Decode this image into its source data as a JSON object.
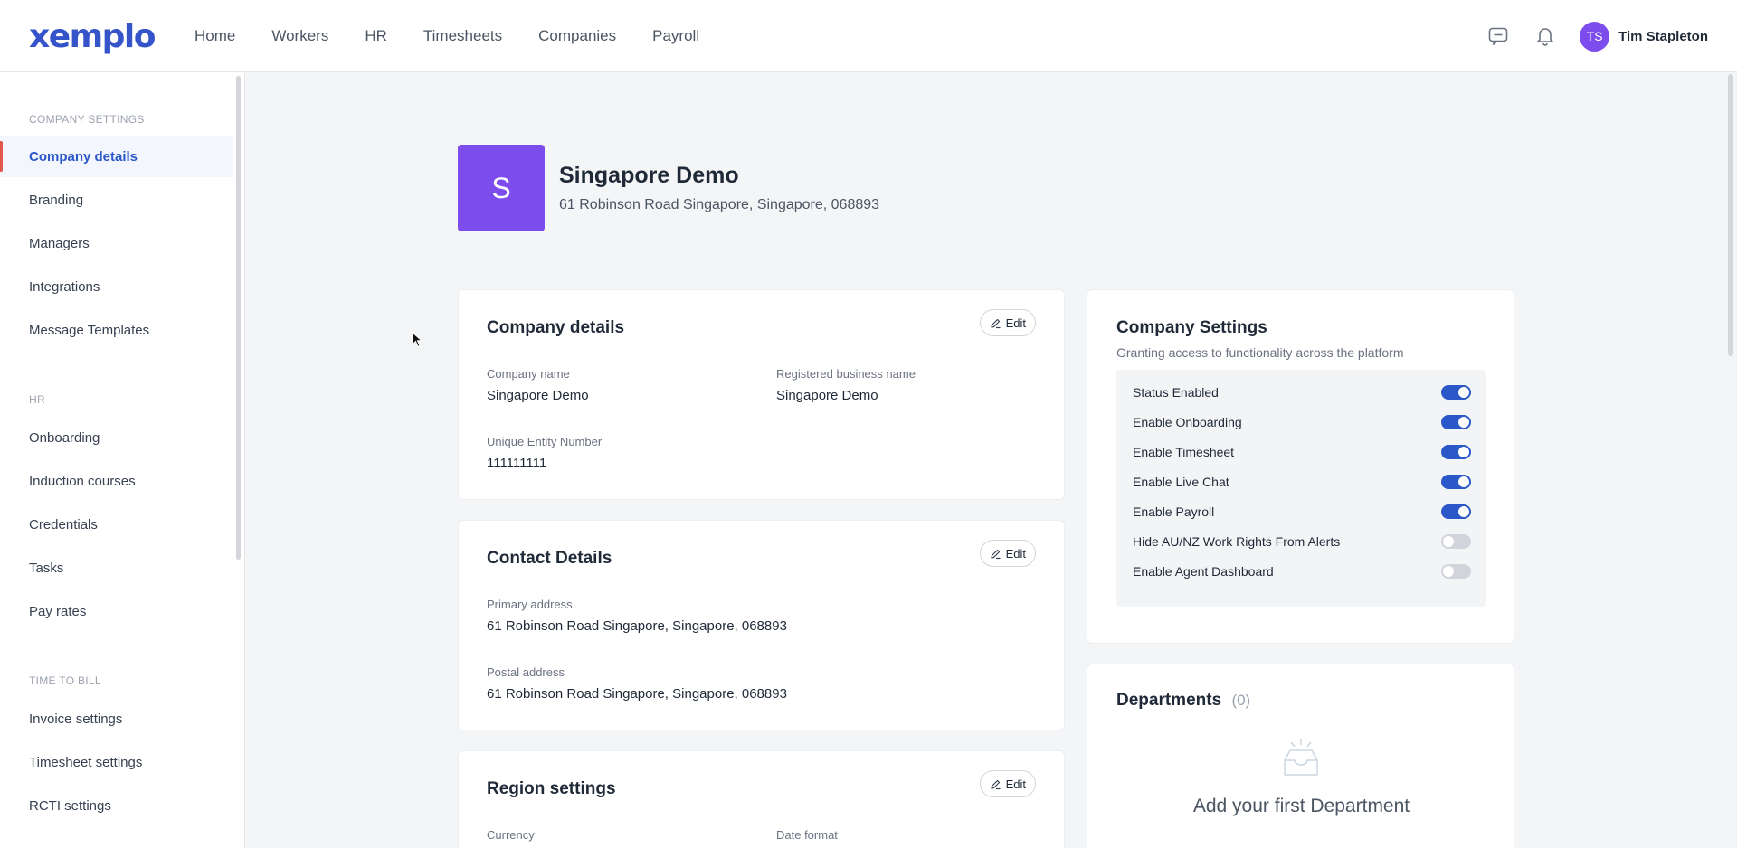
{
  "header": {
    "logo": "xemplo",
    "nav": [
      "Home",
      "Workers",
      "HR",
      "Timesheets",
      "Companies",
      "Payroll"
    ],
    "user_initials": "TS",
    "user_name": "Tim Stapleton",
    "icons": [
      "chat-icon",
      "bell-icon"
    ]
  },
  "sidebar": {
    "sections": [
      {
        "title": "COMPANY SETTINGS",
        "items": [
          "Company details",
          "Branding",
          "Managers",
          "Integrations",
          "Message Templates"
        ]
      },
      {
        "title": "HR",
        "items": [
          "Onboarding",
          "Induction courses",
          "Credentials",
          "Tasks",
          "Pay rates"
        ]
      },
      {
        "title": "TIME TO BILL",
        "items": [
          "Invoice settings",
          "Timesheet settings",
          "RCTI settings"
        ]
      }
    ],
    "active": "Company details"
  },
  "company": {
    "initial": "S",
    "name": "Singapore Demo",
    "address": "61 Robinson Road Singapore, Singapore, 068893"
  },
  "details_card": {
    "title": "Company details",
    "edit": "Edit",
    "fields": [
      {
        "label": "Company name",
        "value": "Singapore Demo"
      },
      {
        "label": "Registered business name",
        "value": "Singapore Demo"
      },
      {
        "label": "Unique Entity Number",
        "value": "111111111"
      }
    ]
  },
  "contact_card": {
    "title": "Contact Details",
    "edit": "Edit",
    "fields": [
      {
        "label": "Primary address",
        "value": "61 Robinson Road Singapore, Singapore, 068893"
      },
      {
        "label": "Postal address",
        "value": "61 Robinson Road Singapore, Singapore, 068893"
      }
    ]
  },
  "region_card": {
    "title": "Region settings",
    "edit": "Edit",
    "fields": [
      {
        "label": "Currency"
      },
      {
        "label": "Date format"
      }
    ]
  },
  "settings_card": {
    "title": "Company Settings",
    "subtitle": "Granting access to functionality across the platform",
    "toggles": [
      {
        "label": "Status Enabled",
        "on": true
      },
      {
        "label": "Enable Onboarding",
        "on": true
      },
      {
        "label": "Enable Timesheet",
        "on": true
      },
      {
        "label": "Enable Live Chat",
        "on": true
      },
      {
        "label": "Enable Payroll",
        "on": true
      },
      {
        "label": "Hide AU/NZ Work Rights From Alerts",
        "on": false
      },
      {
        "label": "Enable Agent Dashboard",
        "on": false
      }
    ]
  },
  "departments_card": {
    "title": "Departments",
    "count": "(0)",
    "empty_text": "Add your first Department"
  },
  "colors": {
    "brand": "#3554c9",
    "avatar": "#7c4dec",
    "toggle_on": "#2b58c9",
    "toggle_off": "#d1d5db",
    "active_marker": "#e2564e"
  }
}
